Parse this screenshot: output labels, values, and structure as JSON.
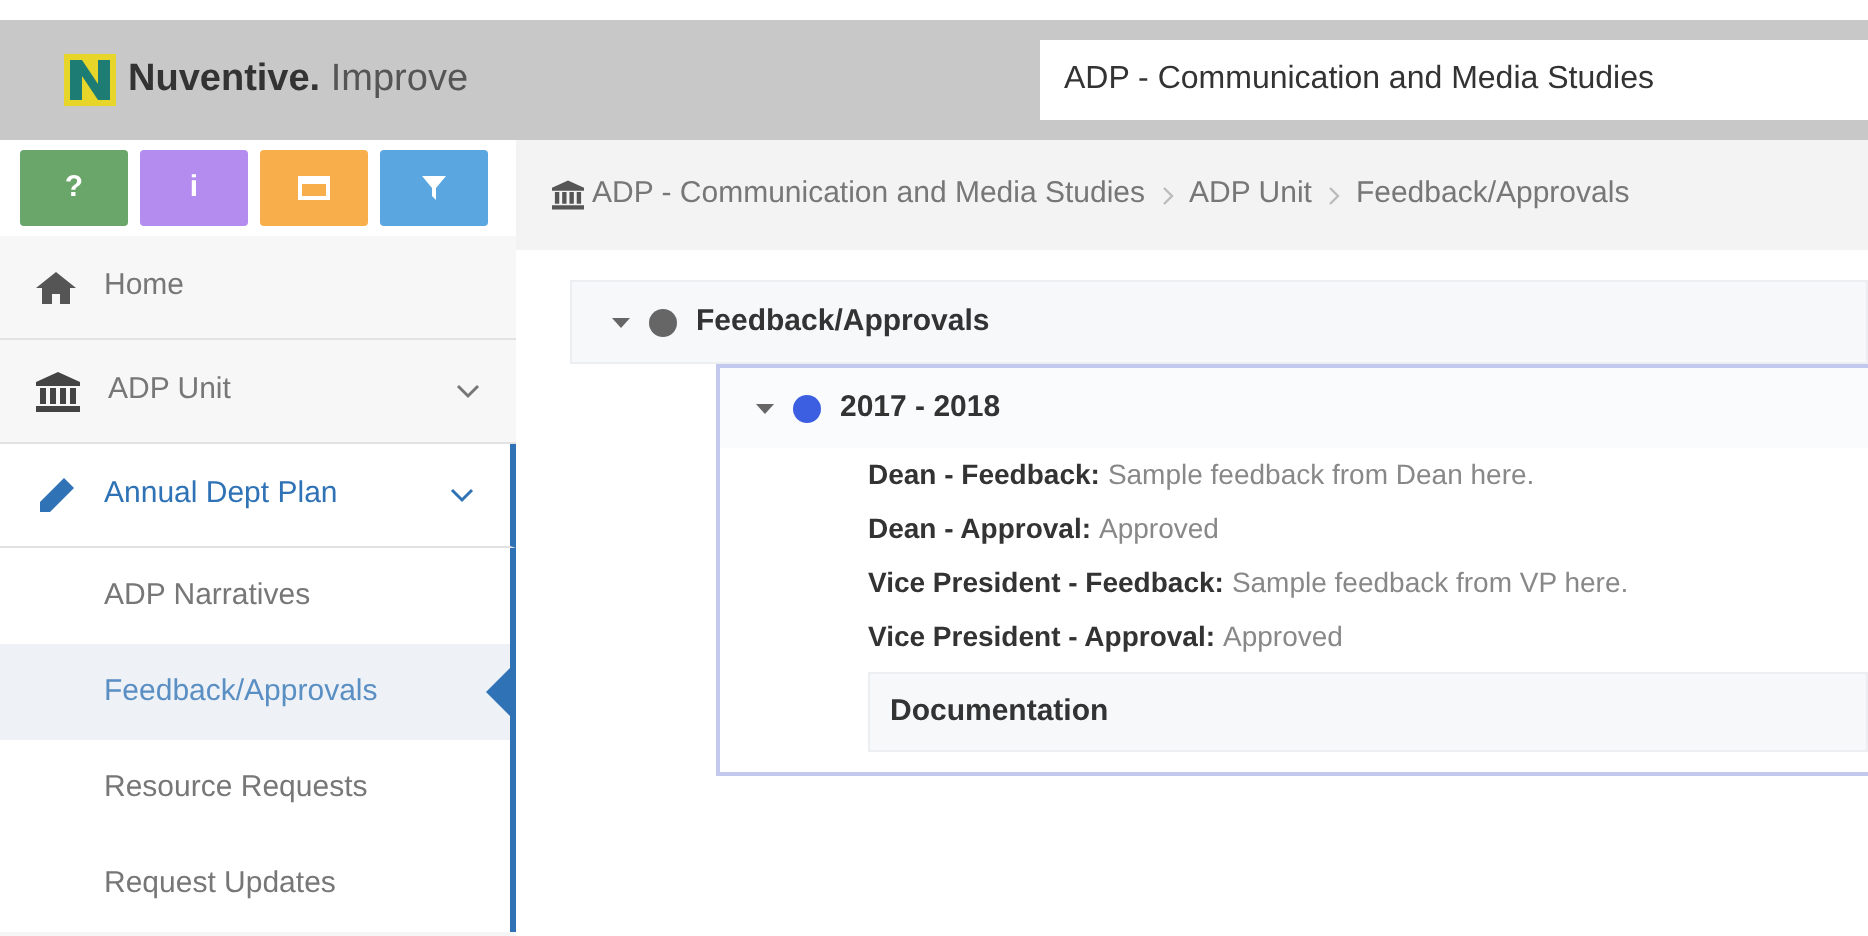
{
  "header": {
    "brand": "Nuventive.",
    "product": "Improve",
    "unit_field": "ADP - Communication and Media Studies"
  },
  "toolbar": [
    {
      "kind": "help",
      "label": "?",
      "color": "#6aa56a"
    },
    {
      "kind": "info",
      "label": "i",
      "color": "#b48cf0"
    },
    {
      "kind": "calendar",
      "color": "#f7ae4b"
    },
    {
      "kind": "filter",
      "color": "#5aa6e0"
    }
  ],
  "sidebar": {
    "items": [
      {
        "label": "Home",
        "kind": "home",
        "selected": false
      },
      {
        "label": "ADP Unit",
        "kind": "bank",
        "selected": false,
        "expanded": false
      },
      {
        "label": "Annual Dept Plan",
        "kind": "pencil",
        "selected": false,
        "expanded": true,
        "children": [
          {
            "label": "ADP Narratives",
            "selected": false
          },
          {
            "label": "Feedback/Approvals",
            "selected": true
          },
          {
            "label": "Resource Requests",
            "selected": false
          },
          {
            "label": "Request Updates",
            "selected": false
          }
        ]
      }
    ]
  },
  "breadcrumb": [
    "ADP - Communication and Media Studies",
    "ADP Unit",
    "Feedback/Approvals"
  ],
  "section": {
    "title": "Feedback/Approvals",
    "expanded": true,
    "items": [
      {
        "title": "2017 - 2018",
        "expanded": true,
        "fields": [
          {
            "label": "Dean - Feedback:",
            "value": "Sample feedback from Dean here."
          },
          {
            "label": "Dean - Approval:",
            "value": "Approved"
          },
          {
            "label": "Vice President - Feedback:",
            "value": "Sample feedback from VP here."
          },
          {
            "label": "Vice President - Approval:",
            "value": "Approved"
          }
        ],
        "documentation": "Documentation"
      }
    ]
  }
}
